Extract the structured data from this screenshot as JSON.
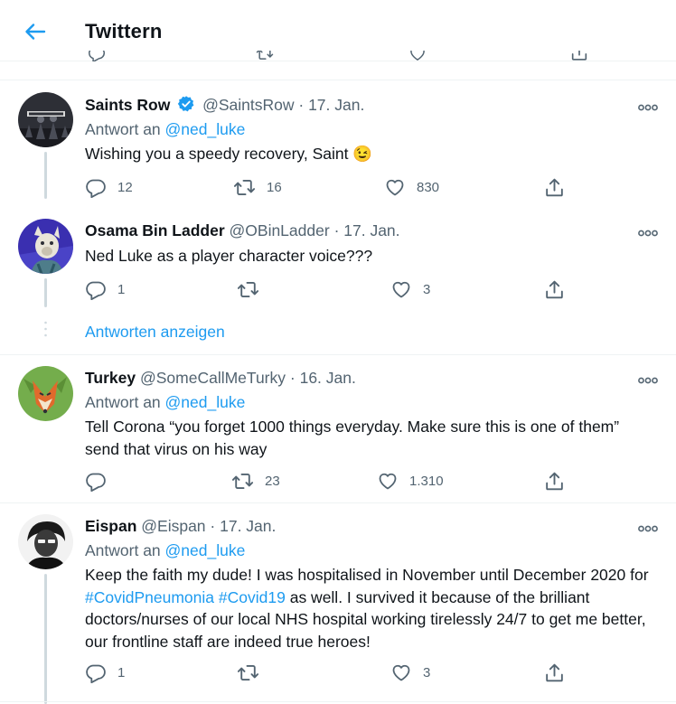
{
  "header": {
    "title": "Twittern"
  },
  "tweets": [
    {
      "name": "Saints Row",
      "verified": true,
      "handle": "@SaintsRow",
      "date": "· 17. Jan.",
      "reply_prefix": "Antwort an",
      "reply_to": "@ned_luke",
      "text": "Wishing you a speedy recovery, Saint 😉",
      "replies": "12",
      "retweets": "16",
      "likes": "830"
    },
    {
      "name": "Osama Bin Ladder",
      "handle": "@OBinLadder",
      "date": "· 17. Jan.",
      "text": "Ned Luke as a player character voice???",
      "replies": "1",
      "retweets": "",
      "likes": "3"
    },
    {
      "name": "Turkey",
      "handle": "@SomeCallMeTurky",
      "date": "· 16. Jan.",
      "reply_prefix": "Antwort an",
      "reply_to": "@ned_luke",
      "text_line1": "Tell Corona “you forget 1000 things everyday. Make sure this is one of them”",
      "text_line2": "send that virus on his way",
      "replies": "",
      "retweets": "23",
      "likes": "1.310"
    },
    {
      "name": "Eispan",
      "handle": "@Eispan",
      "date": "· 17. Jan.",
      "reply_prefix": "Antwort an",
      "reply_to": "@ned_luke",
      "text_a": "Keep the faith my dude! I was hospitalised in November until December 2020 for ",
      "hashtag1": "#CovidPneumonia",
      "hashtag2": "#Covid19",
      "text_b": " as well. I survived it because of the brilliant doctors/nurses of our local NHS hospital working tirelessly 24/7 to get me better, our frontline staff are indeed true heroes!",
      "replies": "1",
      "retweets": "",
      "likes": "3"
    }
  ],
  "show_replies": "Antworten anzeigen",
  "colors": {
    "accent": "#1d9bf0",
    "secondary_text": "#536471",
    "divider": "#eff3f4",
    "thread_line": "#cfd9de"
  },
  "icons": [
    "arrow-left-icon",
    "more-icon",
    "reply-icon",
    "retweet-icon",
    "like-icon",
    "share-icon",
    "verified-badge-icon",
    "wink-emoji"
  ]
}
